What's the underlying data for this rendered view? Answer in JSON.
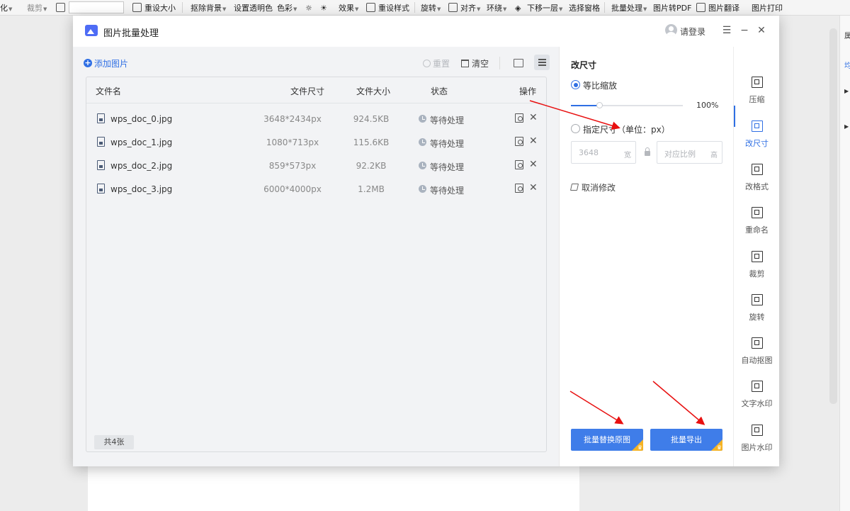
{
  "background": {
    "toolbar": [
      {
        "id": "fragment",
        "label": "化",
        "caret": true
      },
      {
        "id": "crop",
        "label": "裁剪",
        "caret": true
      },
      {
        "id": "resize",
        "label": "重设大小"
      },
      {
        "id": "remove-bg",
        "label": "抠除背景",
        "caret": true
      },
      {
        "id": "transparent",
        "label": "设置透明色"
      },
      {
        "id": "color",
        "label": "色彩",
        "caret": true
      },
      {
        "id": "effect",
        "label": "效果",
        "caret": true
      },
      {
        "id": "reset-style",
        "label": "重设样式"
      },
      {
        "id": "rotate",
        "label": "旋转",
        "caret": true
      },
      {
        "id": "align",
        "label": "对齐",
        "caret": true
      },
      {
        "id": "wrap",
        "label": "环绕",
        "caret": true
      },
      {
        "id": "send-back",
        "label": "下移一层",
        "caret": true
      },
      {
        "id": "selection-pane",
        "label": "选择窗格"
      },
      {
        "id": "batch",
        "label": "批量处理",
        "caret": true
      },
      {
        "id": "to-pdf",
        "label": "图片转PDF"
      },
      {
        "id": "translate",
        "label": "图片翻译"
      },
      {
        "id": "print",
        "label": "图片打印"
      }
    ],
    "right_panel_chars": [
      "属",
      "均"
    ]
  },
  "dialog": {
    "title": "图片批量处理",
    "login": "请登录",
    "header_buttons": {
      "menu": "☰",
      "minimize": "−",
      "close": "✕"
    }
  },
  "left": {
    "add_button": "添加图片",
    "reset": "重置",
    "clear": "清空",
    "columns": {
      "name": "文件名",
      "dimensions": "文件尺寸",
      "size": "文件大小",
      "status": "状态",
      "action": "操作"
    },
    "files": [
      {
        "name": "wps_doc_0.jpg",
        "dimensions": "3648*2434px",
        "size": "924.5KB",
        "status": "等待处理"
      },
      {
        "name": "wps_doc_1.jpg",
        "dimensions": "1080*713px",
        "size": "115.6KB",
        "status": "等待处理"
      },
      {
        "name": "wps_doc_2.jpg",
        "dimensions": "859*573px",
        "size": "92.2KB",
        "status": "等待处理"
      },
      {
        "name": "wps_doc_3.jpg",
        "dimensions": "6000*4000px",
        "size": "1.2MB",
        "status": "等待处理"
      }
    ],
    "count": "共4张"
  },
  "options": {
    "title": "改尺寸",
    "proportional": {
      "label": "等比缩放",
      "selected": true,
      "percent_text": "100%",
      "slider_fraction": 0.25
    },
    "specified": {
      "label": "指定尺寸（单位：px）",
      "selected": false
    },
    "width_value": "3648",
    "width_unit": "宽",
    "height_placeholder": "对应比例",
    "height_unit": "高",
    "undo": "取消修改",
    "buttons": {
      "replace": "批量替换原图",
      "export": "批量导出"
    }
  },
  "nav": {
    "active": "改尺寸",
    "items": [
      "压缩",
      "改尺寸",
      "改格式",
      "重命名",
      "裁剪",
      "旋转",
      "自动抠图",
      "文字水印",
      "图片水印"
    ]
  },
  "colors": {
    "accent": "#2f6fe4",
    "button": "#3f7de9",
    "vip": "#f5b324",
    "annotation": "#e81010"
  }
}
